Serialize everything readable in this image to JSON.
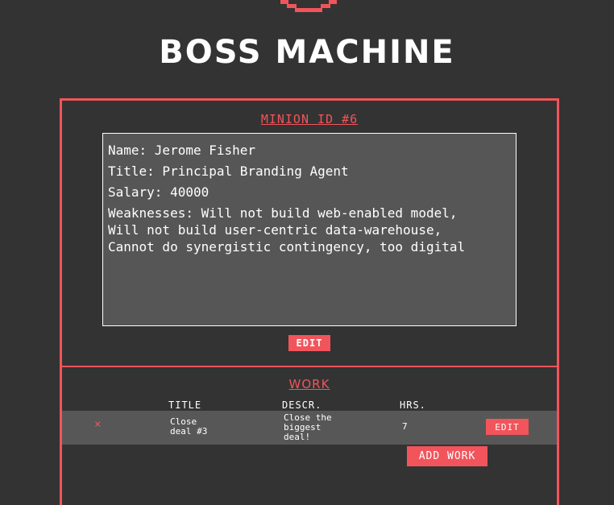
{
  "app": {
    "title": "BOSS MACHINE",
    "accent_color": "#f2545b",
    "logo_icon": "pixel-smile-icon"
  },
  "minion": {
    "heading": "MINION ID #6",
    "name_line": "Name: Jerome Fisher",
    "title_line": "Title: Principal Branding Agent",
    "salary_line": "Salary: 40000",
    "weaknesses_line": "Weaknesses: Will not build web-enabled model,\nWill not build user-centric data-warehouse,\nCannot do synergistic contingency, too digital",
    "edit_label": "EDIT"
  },
  "work": {
    "heading": "WORK",
    "columns": [
      "TITLE",
      "DESCR.",
      "HRS."
    ],
    "rows": [
      {
        "delete_glyph": "×",
        "title": "Close\ndeal #3",
        "description": "Close the\nbiggest\ndeal!",
        "hours": "7",
        "edit_label": "EDIT"
      }
    ],
    "add_label": "ADD WORK"
  }
}
